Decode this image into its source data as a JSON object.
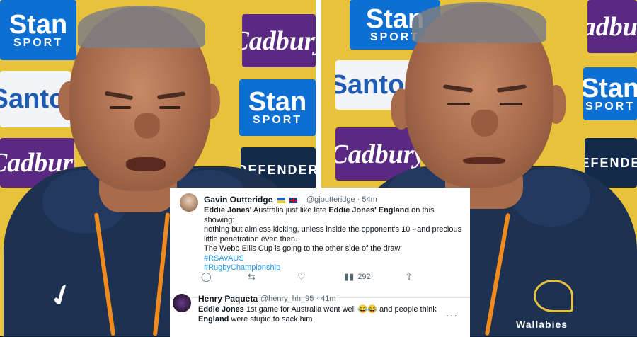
{
  "sponsors": {
    "stan_word": "Stan",
    "stan_sub": "SPORT",
    "cadbury": "Cadbury",
    "santos": "Santos",
    "defender": "DEFENDER"
  },
  "jacket": {
    "asics_mark": "✓",
    "wallabies_label": "Wallabies"
  },
  "tweet1": {
    "name": "Gavin Outteridge",
    "handle": "@gjoutteridge · 54m",
    "line1_a": "Eddie Jones'",
    "line1_b": " Australia just like late ",
    "line1_c": "Eddie Jones' England",
    "line1_d": " on this showing:",
    "line2": "nothing but aimless kicking, unless inside the opponent's 10 - and precious",
    "line3": "little penetration even then.",
    "line4": "The Webb Ellis Cup is going to the other side of the draw",
    "hashtag1": "#RSAvAUS",
    "hashtag2": "#RugbyChampionship",
    "views": "292"
  },
  "tweet2": {
    "name": "Henry Paqueta",
    "handle": "@henry_hh_95 · 41m",
    "line1_a": "Eddie Jones",
    "line1_b": " 1st game for Australia went well ",
    "emoji": "😂😂",
    "line1_c": " and people think",
    "line2_a": "England",
    "line2_b": " were stupid to sack him",
    "more": "···"
  },
  "icons": {
    "reply": "reply-icon",
    "retweet": "retweet-icon",
    "like": "like-icon",
    "views": "views-icon",
    "share": "share-icon",
    "more": "more-icon"
  },
  "colors": {
    "link": "#1d9bf0",
    "jacket": "#1d3152",
    "backdrop": "#e8c23a"
  }
}
